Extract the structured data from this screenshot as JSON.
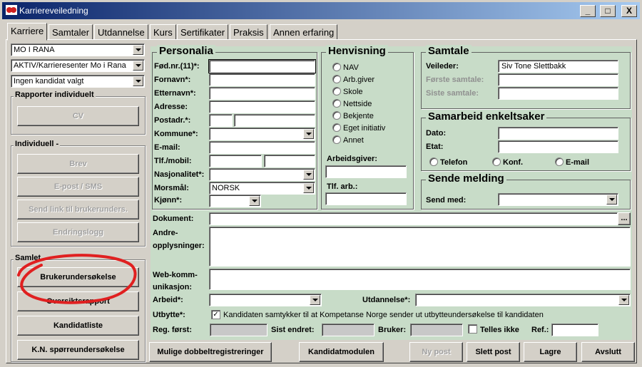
{
  "window": {
    "title": "Karriereveiledning",
    "minimize": "_",
    "maximize": "□",
    "close": "X"
  },
  "tabs": [
    "Karriere",
    "Samtaler",
    "Utdannelse",
    "Kurs",
    "Sertifikater",
    "Praksis",
    "Annen erfaring"
  ],
  "left": {
    "combo1": "MO I RANA",
    "combo2": "AKTIV/Karrieresenter Mo i Rana",
    "combo3": "Ingen kandidat valgt",
    "grp_rapporter": "Rapporter individuelt",
    "btn_cv": "CV",
    "grp_individuelt": "Individuell -",
    "btn_brev": "Brev",
    "btn_epost": "E-post / SMS",
    "btn_sendlink": "Send link til brukerunders.",
    "btn_endringslogg": "Endringslogg",
    "grp_samlet": "Samlet",
    "btn_brukerundersokelse": "Brukerundersøkelse",
    "btn_oversiktsrapport": "Oversiktsrapport",
    "btn_kandidatliste": "Kandidatliste",
    "btn_kn": "K.N. spørreundersøkelse"
  },
  "personalia": {
    "title": "Personalia",
    "fodnr": "Fød.nr.(11)*:",
    "fornavn": "Fornavn*:",
    "etternavn": "Etternavn*:",
    "adresse": "Adresse:",
    "postadr": "Postadr.*:",
    "kommune": "Kommune*:",
    "email": "E-mail:",
    "tlf": "Tlf./mobil:",
    "nasjonalitet": "Nasjonalitet*:",
    "morsmal": "Morsmål:",
    "morsmal_value": "NORSK",
    "kjonn": "Kjønn*:"
  },
  "henvisning": {
    "title": "Henvisning",
    "options": [
      "NAV",
      "Arb.giver",
      "Skole",
      "Nettside",
      "Bekjente",
      "Eget initiativ",
      "Annet"
    ],
    "arbeidsgiver": "Arbeidsgiver:",
    "tlf_arb": "Tlf. arb.:"
  },
  "samtale": {
    "title": "Samtale",
    "veileder": "Veileder:",
    "veileder_value": "Siv Tone Slettbakk",
    "forste": "Første samtale:",
    "siste": "Siste samtale:"
  },
  "samarbeid": {
    "title": "Samarbeid enkeltsaker",
    "dato": "Dato:",
    "etat": "Etat:",
    "telefon": "Telefon",
    "konf": "Konf.",
    "email": "E-mail"
  },
  "sende": {
    "title": "Sende melding",
    "send_med": "Send med:"
  },
  "lower": {
    "dokument": "Dokument:",
    "dokument_btn": "...",
    "andre1": "Andre-",
    "andre2": "opplysninger:",
    "web1": "Web-komm-",
    "web2": "unikasjon:",
    "arbeid": "Arbeid*:",
    "utdannelse": "Utdannelse*:",
    "utbytte": "Utbytte*:",
    "utbytte_text": "Kandidaten samtykker til at Kompetanse Norge sender ut utbytteundersøkelse til kandidaten",
    "utbytte_check": "✓",
    "reg_forst": "Reg. først:",
    "sist_endret": "Sist endret:",
    "bruker": "Bruker:",
    "telles_ikke": "Telles ikke",
    "ref": "Ref.:"
  },
  "bottom": {
    "mulige": "Mulige dobbeltregistreringer",
    "kandidatmodulen": "Kandidatmodulen",
    "ny_post": "Ny post",
    "slett_post": "Slett post",
    "lagre": "Lagre",
    "avslutt": "Avslutt"
  },
  "colors": {
    "form_bg": "#c8dcc8",
    "highlight_circle": "#e02020",
    "titlebar": "#0a246a"
  }
}
